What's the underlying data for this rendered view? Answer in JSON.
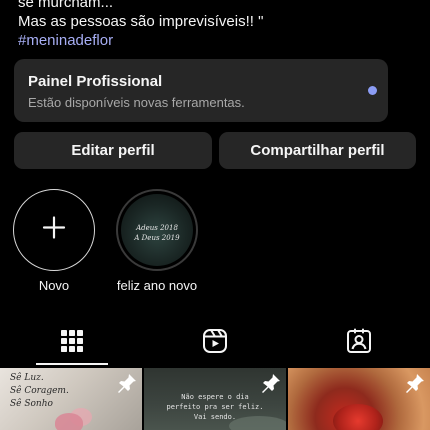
{
  "bio": {
    "line1": "se murcham...",
    "line2": "Mas as pessoas são imprevisíveis!! \"",
    "hashtag": "#meninadeflor"
  },
  "professional_panel": {
    "title": "Painel Profissional",
    "subtitle": "Estão disponíveis novas ferramentas.",
    "dot_color": "#8b9cf4"
  },
  "buttons": {
    "edit_profile": "Editar perfil",
    "share_profile": "Compartilhar perfil"
  },
  "highlights": [
    {
      "label": "Novo",
      "icon": "plus-icon"
    },
    {
      "label": "feliz ano novo",
      "cover_lines": [
        "Adeus 2018",
        "A Deus 2019"
      ]
    }
  ],
  "tabs": [
    {
      "name": "grid",
      "icon": "grid-icon",
      "active": true
    },
    {
      "name": "reels",
      "icon": "reels-icon",
      "active": false
    },
    {
      "name": "tagged",
      "icon": "tagged-person-icon",
      "active": false
    }
  ],
  "posts": [
    {
      "text_lines": [
        "Sê Luz.",
        "Sê Coragem.",
        "Sê Sonho"
      ],
      "pinned": true
    },
    {
      "text_lines": [
        "Não espere o dia",
        "perfeito pra ser feliz.",
        "Vai sendo."
      ],
      "pinned": true
    },
    {
      "text_lines": [],
      "pinned": true
    }
  ],
  "colors": {
    "background": "#000000",
    "surface": "#262626",
    "hashtag": "#a7aef4",
    "muted_text": "#a8a8a8"
  }
}
